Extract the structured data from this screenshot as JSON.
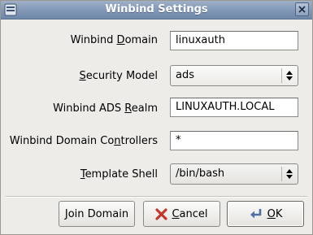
{
  "window": {
    "title": "Winbind Settings"
  },
  "fields": {
    "winbind_domain": {
      "label_pre": "Winbind ",
      "label_mnemonic": "D",
      "label_post": "omain",
      "value": "linuxauth"
    },
    "security_model": {
      "label_pre": "",
      "label_mnemonic": "S",
      "label_post": "ecurity Model",
      "value": "ads"
    },
    "ads_realm": {
      "label_pre": "Winbind ADS ",
      "label_mnemonic": "R",
      "label_post": "ealm",
      "value": "LINUXAUTH.LOCAL"
    },
    "domain_controllers": {
      "label_pre": "Winbind Domain Co",
      "label_mnemonic": "n",
      "label_post": "trollers",
      "value": "*"
    },
    "template_shell": {
      "label_pre": "",
      "label_mnemonic": "T",
      "label_post": "emplate Shell",
      "value": "/bin/bash"
    }
  },
  "buttons": {
    "join": {
      "mnemonic": "J",
      "rest": "oin Domain"
    },
    "cancel": {
      "mnemonic": "C",
      "rest": "ancel",
      "icon": "cancel-x-icon"
    },
    "ok": {
      "mnemonic": "O",
      "rest": "K",
      "icon": "enter-arrow-icon"
    }
  },
  "colors": {
    "titlebar": "#8299b6",
    "cancel_icon": "#c0392b",
    "ok_icon": "#4d6fa3"
  }
}
